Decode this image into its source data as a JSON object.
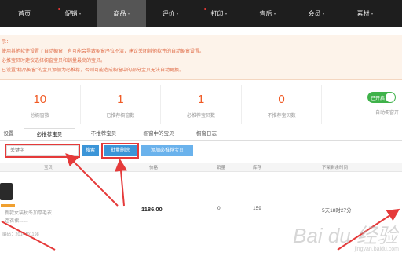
{
  "nav": [
    {
      "label": "首页",
      "caret": "",
      "dot": false
    },
    {
      "label": "促销",
      "caret": "▾",
      "dot": true
    },
    {
      "label": "商品",
      "caret": "▾",
      "dot": false,
      "active": true
    },
    {
      "label": "评价",
      "caret": "▾",
      "dot": false
    },
    {
      "label": "打印",
      "caret": "▾",
      "dot": true
    },
    {
      "label": "售后",
      "caret": "▾",
      "dot": false
    },
    {
      "label": "会员",
      "caret": "▾",
      "dot": false
    },
    {
      "label": "素材",
      "caret": "▾",
      "dot": false
    }
  ],
  "notice": {
    "lines": [
      "示：",
      "使用其他软件设置了自动橱窗，有可能会导致橱窗序位不清，建议关闭其他软件的自动橱窗设置。",
      "必推宝贝时建议选择橱窗宝贝和销量最高的宝贝。",
      "已设置“精品橱窗”的宝贝添加为必推荐，否则可能造成橱窗中的部分宝贝无法自动更换。"
    ]
  },
  "stats": [
    {
      "num": "10",
      "label": "总橱窗数"
    },
    {
      "num": "1",
      "label": "已推荐橱窗数"
    },
    {
      "num": "1",
      "label": "必推荐宝贝数"
    },
    {
      "num": "0",
      "label": "不推荐宝贝数"
    }
  ],
  "auto_toggle": {
    "label": "已开启",
    "caption": "自动橱窗开",
    "on": true
  },
  "tabs": [
    "设置",
    "必推荐宝贝",
    "不推荐宝贝",
    "橱窗中的宝贝",
    "橱窗日志"
  ],
  "search": {
    "placeholder": "关键字"
  },
  "buttons": {
    "search": "搜索",
    "batch_delete": "批量删除",
    "add": "添加必推荐宝贝"
  },
  "table": {
    "headers": [
      "宝贝",
      "价格",
      "销量",
      "库存",
      "下架剩余时间"
    ],
    "row": {
      "title_lines": [
        "新款女装秋冬加厚毛衣",
        "连衣裙……"
      ],
      "price": "1186.00",
      "sales": "0",
      "stock": "159",
      "remaining": "5天18时27分",
      "id_text": "编码：2014491198"
    }
  },
  "watermark": {
    "brand": "Bai du 经验",
    "url": "jingyan.baidu.com"
  },
  "colors": {
    "accent_orange": "#f05a24",
    "nav_bg": "#1e1e1e",
    "btn_blue": "#3b95d8",
    "toggle_green": "#3fb24a",
    "annotation_red": "#e53a3a"
  }
}
